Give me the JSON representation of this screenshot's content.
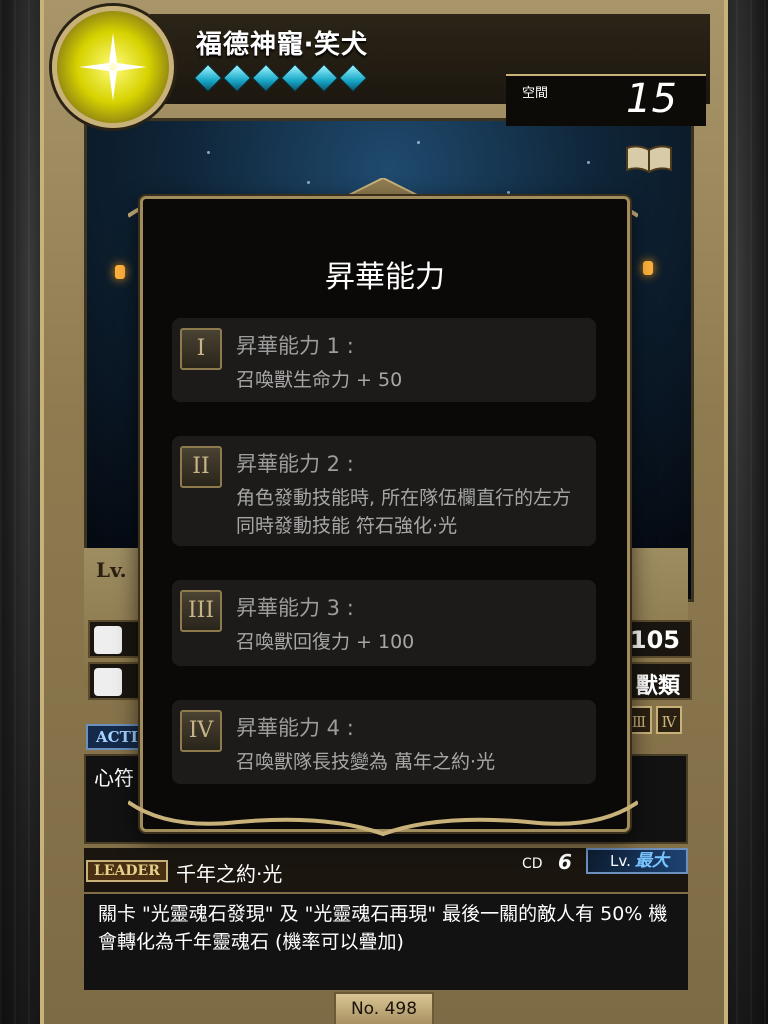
{
  "card": {
    "name": "福德神寵‧笑犬",
    "star_count": 6,
    "space_label": "空間",
    "space_value": "15",
    "level_label": "Lv.",
    "active_tag": "ACTIV",
    "skill_text_partial": "心符",
    "stat_value": "105",
    "race": "獸類",
    "leader_tag": "LEADER",
    "leader_skill_name": "千年之約‧光",
    "cd_label": "CD",
    "cd_value": "6",
    "lv_prefix": "Lv.",
    "lv_max": "最大",
    "leader_description": "關卡 \"光靈魂石發現\" 及 \"光靈魂石再現\" 最後一關的敵人有 50% 機會轉化為千年靈魂石 (機率可以疊加)",
    "number": "No. 498",
    "mini_roman": [
      "Ⅲ",
      "Ⅳ"
    ],
    "colors": {
      "gem": "#18a7c7",
      "emblem": "#d6d200",
      "frame": "#c9b27a"
    }
  },
  "popup": {
    "title": "昇華能力",
    "abilities": [
      {
        "numeral": "I",
        "title": "昇華能力 1 :",
        "desc": "召喚獸生命力 + 50"
      },
      {
        "numeral": "II",
        "title": "昇華能力 2 :",
        "desc": "角色發動技能時, 所在隊伍欄直行的左方同時發動技能 符石強化‧光"
      },
      {
        "numeral": "III",
        "title": "昇華能力 3 :",
        "desc": "召喚獸回復力 + 100"
      },
      {
        "numeral": "IV",
        "title": "昇華能力 4 :",
        "desc": "召喚獸隊長技變為 萬年之約‧光"
      }
    ]
  }
}
